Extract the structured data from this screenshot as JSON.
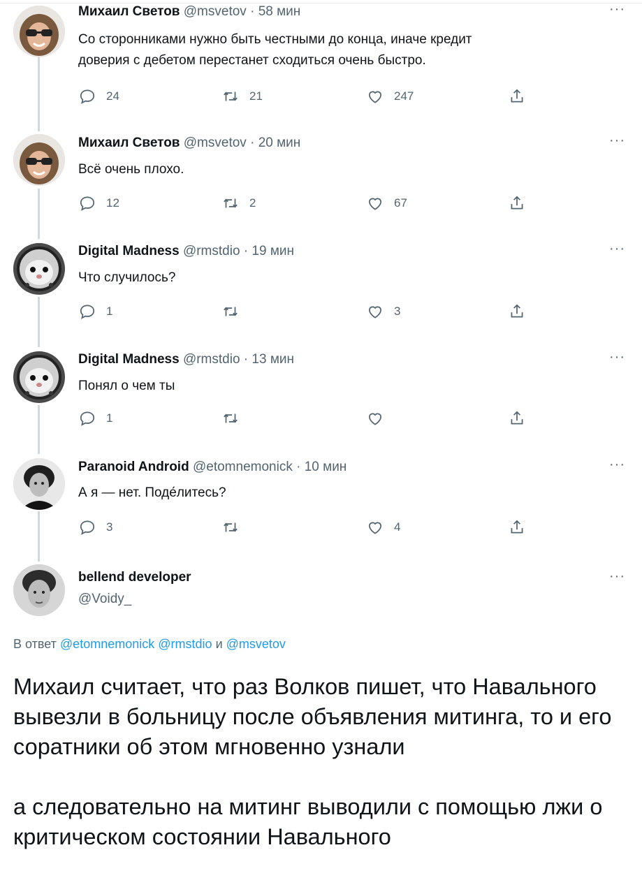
{
  "tweets": [
    {
      "name": "Михаил Светов",
      "handle": "@msvetov",
      "dot": "·",
      "time": "58 мин",
      "text_lines": [
        "Со сторонниками нужно быть честными до конца, иначе кредит",
        "доверия с дебетом перестанет сходиться очень быстро."
      ],
      "replies": "24",
      "retweets": "21",
      "likes": "247",
      "more": "···"
    },
    {
      "name": "Михаил Светов",
      "handle": "@msvetov",
      "dot": "·",
      "time": "20 мин",
      "text_lines": [
        "Всё очень плохо."
      ],
      "replies": "12",
      "retweets": "2",
      "likes": "67",
      "more": "···"
    },
    {
      "name": "Digital Madness",
      "handle": "@rmstdio",
      "dot": "·",
      "time": "19 мин",
      "text_lines": [
        "Что случилось?"
      ],
      "replies": "1",
      "retweets": "",
      "likes": "3",
      "more": "···"
    },
    {
      "name": "Digital Madness",
      "handle": "@rmstdio",
      "dot": "·",
      "time": "13 мин",
      "text_lines": [
        "Понял о чем ты"
      ],
      "replies": "1",
      "retweets": "",
      "likes": "",
      "more": "···"
    },
    {
      "name": "Paranoid Android",
      "handle": "@etomnemonick",
      "dot": "·",
      "time": "10 мин",
      "text_lines": [
        "А я — нет. Поде́литесь?"
      ],
      "replies": "3",
      "retweets": "",
      "likes": "4",
      "more": "···"
    }
  ],
  "main": {
    "name": "bellend developer",
    "handle": "@Voidy_",
    "more": "···",
    "reply_prefix": "В ответ",
    "mention1": "@etomnemonick",
    "mention2": "@rmstdio",
    "conj": "и",
    "mention3": "@msvetov",
    "para1": "Михаил считает, что раз Волков пишет, что Навального вывезли в больницу после объявления митинга, то и его соратники об этом мгновенно узнали",
    "para2": "а следовательно на митинг выводили с помощью лжи о критическом состоянии Навального"
  }
}
